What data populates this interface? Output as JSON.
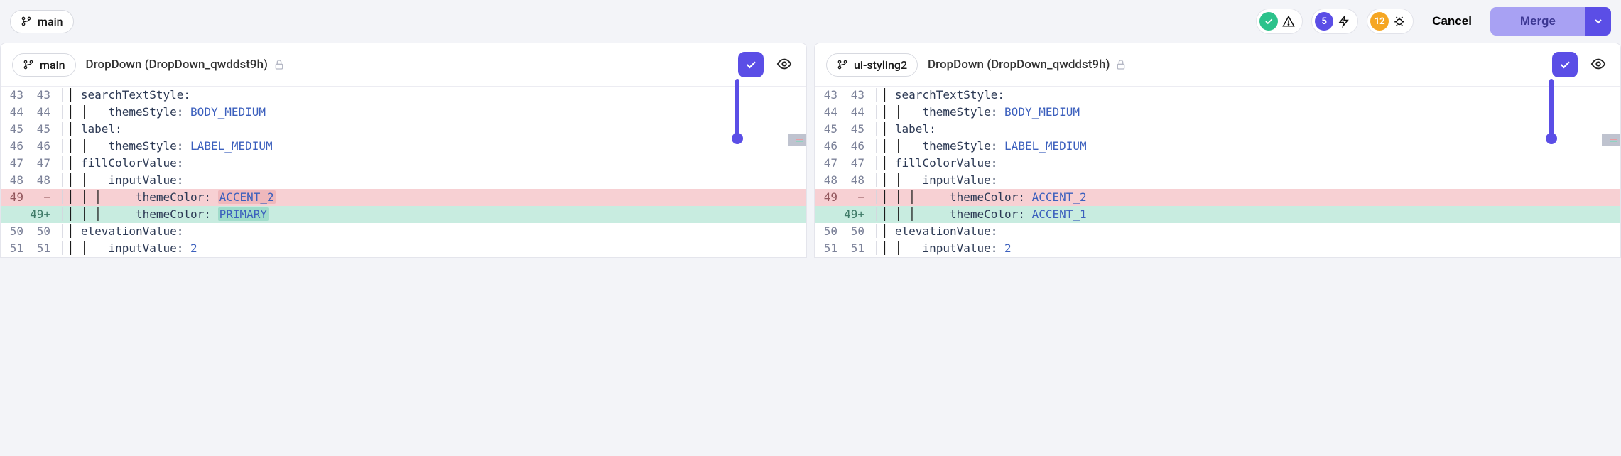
{
  "toolbar": {
    "branch": "main",
    "statuses": {
      "conflict_count": "5",
      "warning_count": "12"
    },
    "cancel_label": "Cancel",
    "merge_label": "Merge"
  },
  "panes": [
    {
      "branch": "main",
      "title": "DropDown (DropDown_qwddst9h)"
    },
    {
      "branch": "ui-styling2",
      "title": "DropDown (DropDown_qwddst9h)"
    }
  ],
  "diff": {
    "left": [
      {
        "a": "43",
        "b": "43",
        "type": "ctx",
        "indent": 0,
        "key": "searchTextStyle:",
        "val": ""
      },
      {
        "a": "44",
        "b": "44",
        "type": "ctx",
        "indent": 1,
        "key": "themeStyle:",
        "val": "BODY_MEDIUM"
      },
      {
        "a": "45",
        "b": "45",
        "type": "ctx",
        "indent": 0,
        "key": "label:",
        "val": ""
      },
      {
        "a": "46",
        "b": "46",
        "type": "ctx",
        "indent": 1,
        "key": "themeStyle:",
        "val": "LABEL_MEDIUM"
      },
      {
        "a": "47",
        "b": "47",
        "type": "ctx",
        "indent": 0,
        "key": "fillColorValue:",
        "val": ""
      },
      {
        "a": "48",
        "b": "48",
        "type": "ctx",
        "indent": 1,
        "key": "inputValue:",
        "val": ""
      },
      {
        "a": "49",
        "b": "−",
        "type": "del",
        "indent": 2,
        "key": "themeColor:",
        "val": "ACCENT_2",
        "hl": true
      },
      {
        "a": "",
        "b": "49+",
        "type": "add",
        "indent": 2,
        "key": "themeColor:",
        "val": "PRIMARY",
        "hl": true
      },
      {
        "a": "50",
        "b": "50",
        "type": "ctx",
        "indent": 0,
        "key": "elevationValue:",
        "val": ""
      },
      {
        "a": "51",
        "b": "51",
        "type": "ctx",
        "indent": 1,
        "key": "inputValue:",
        "val": "2"
      }
    ],
    "right": [
      {
        "a": "43",
        "b": "43",
        "type": "ctx",
        "indent": 0,
        "key": "searchTextStyle:",
        "val": ""
      },
      {
        "a": "44",
        "b": "44",
        "type": "ctx",
        "indent": 1,
        "key": "themeStyle:",
        "val": "BODY_MEDIUM"
      },
      {
        "a": "45",
        "b": "45",
        "type": "ctx",
        "indent": 0,
        "key": "label:",
        "val": ""
      },
      {
        "a": "46",
        "b": "46",
        "type": "ctx",
        "indent": 1,
        "key": "themeStyle:",
        "val": "LABEL_MEDIUM"
      },
      {
        "a": "47",
        "b": "47",
        "type": "ctx",
        "indent": 0,
        "key": "fillColorValue:",
        "val": ""
      },
      {
        "a": "48",
        "b": "48",
        "type": "ctx",
        "indent": 1,
        "key": "inputValue:",
        "val": ""
      },
      {
        "a": "49",
        "b": "−",
        "type": "del",
        "indent": 2,
        "key": "themeColor:",
        "val": "ACCENT_2",
        "hl": false
      },
      {
        "a": "",
        "b": "49+",
        "type": "add",
        "indent": 2,
        "key": "themeColor:",
        "val": "ACCENT_1",
        "hl": false
      },
      {
        "a": "50",
        "b": "50",
        "type": "ctx",
        "indent": 0,
        "key": "elevationValue:",
        "val": ""
      },
      {
        "a": "51",
        "b": "51",
        "type": "ctx",
        "indent": 1,
        "key": "inputValue:",
        "val": "2"
      }
    ]
  }
}
